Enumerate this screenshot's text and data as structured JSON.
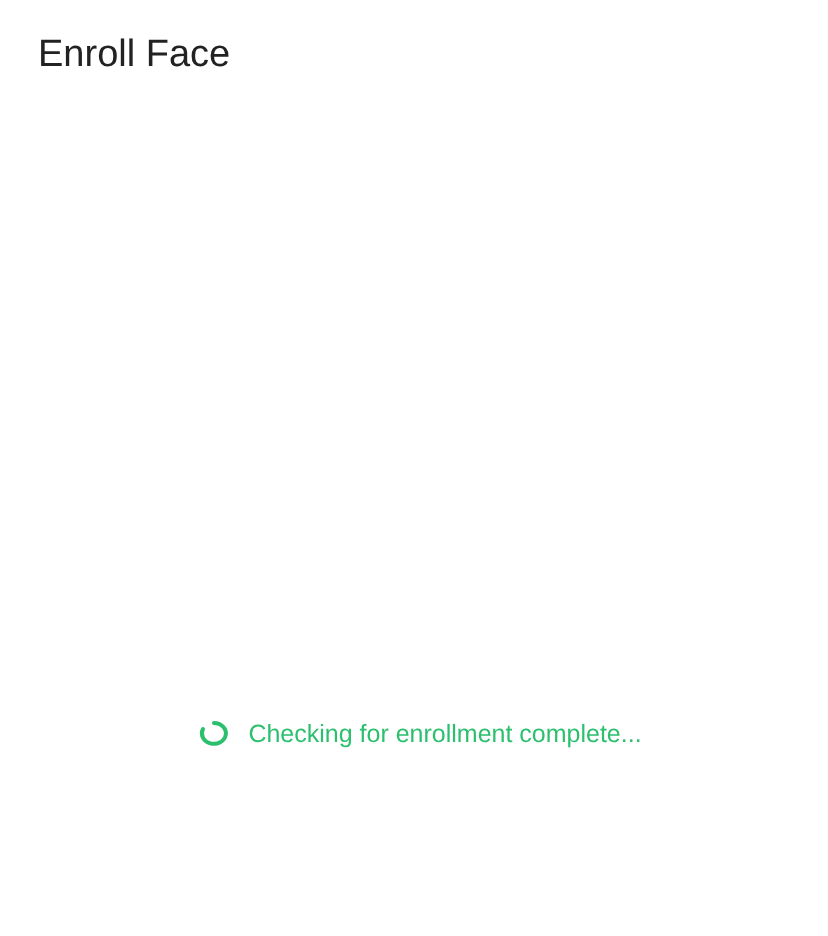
{
  "title": "Enroll Face",
  "status": {
    "message": "Checking for enrollment complete..."
  }
}
